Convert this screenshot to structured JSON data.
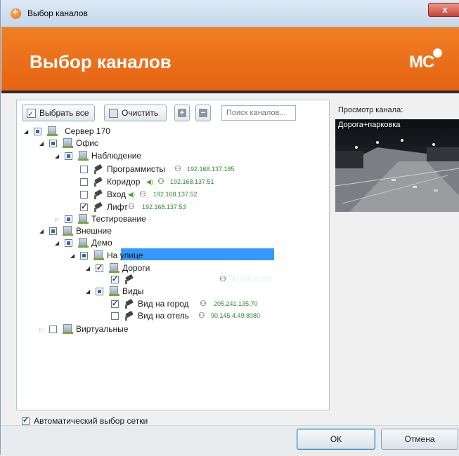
{
  "window": {
    "title": "Выбор каналов",
    "close_label": "x"
  },
  "header": {
    "title": "Выбор каналов",
    "logo": "MC"
  },
  "toolbar": {
    "select_all_label": "Выбрать все",
    "clear_label": "Очистить",
    "expand_icon": "+",
    "collapse_icon": "−",
    "search_placeholder": "Поиск каналов..."
  },
  "tree": {
    "server": "Сервер 170",
    "office": "Офис",
    "observation": "Наблюдение",
    "programmers": "Программисты",
    "programmers_ip": "192.168.137.185",
    "corridor": "Коридор",
    "corridor_ip": "192.168.137.51",
    "entrance": "Вход",
    "entrance_ip": "192.168.137.52",
    "elevator": "Лифт",
    "elevator_ip": "192.168.137.53",
    "testing": "Тестирование",
    "external": "Внешние",
    "demo": "Демо",
    "outside": "На улице",
    "roads": "Дороги",
    "road_parking": "Дорога+парковка",
    "road_parking_ip": "87.139.20.112",
    "views": "Виды",
    "city_view": "Вид на город",
    "city_view_ip": "205.241.135.70",
    "hotel_view": "Вид на отель",
    "hotel_view_ip": "90.145.4.49:8080",
    "virtual": "Виртуальные"
  },
  "auto_grid": {
    "label": "Автоматический выбор сетки",
    "checked": true
  },
  "preview": {
    "label": "Просмотр канала:",
    "channel_name": "Дорога+парковка"
  },
  "buttons": {
    "ok": "ОК",
    "cancel": "Отмена"
  },
  "colors": {
    "header_orange": "#e86a14",
    "ip_green": "#2f8a2f",
    "selection_blue": "#3399ff"
  }
}
